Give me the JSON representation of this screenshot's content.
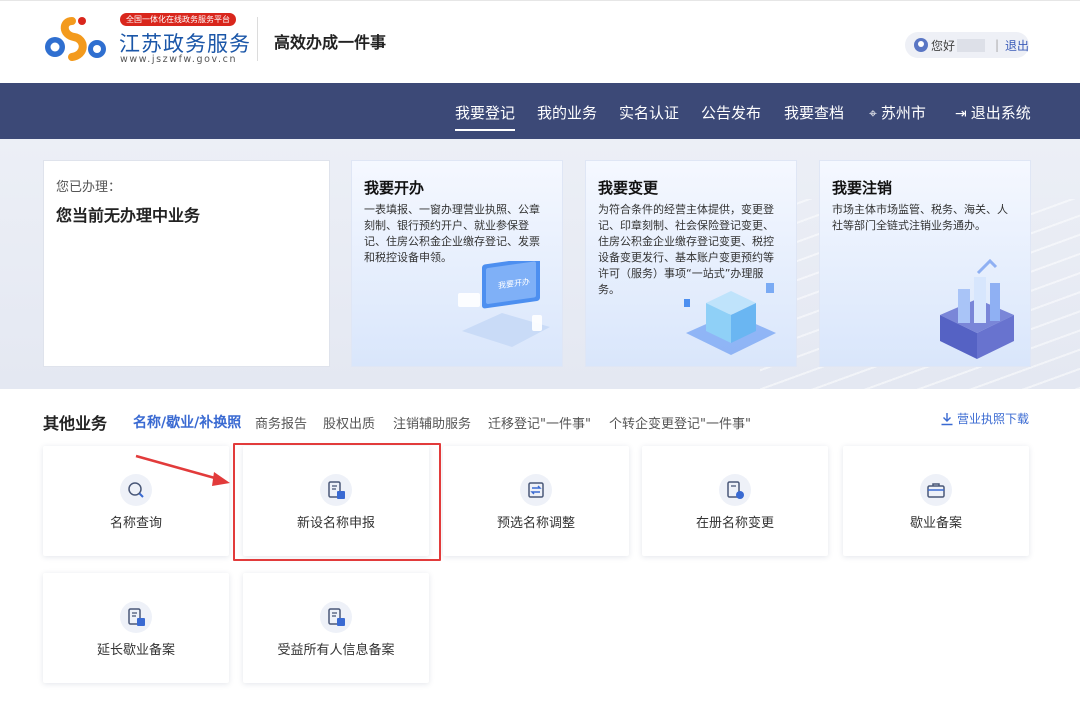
{
  "header": {
    "badge": "全国一体化在线政务服务平台",
    "site_name": "江苏政务服务",
    "site_url": "www.jszwfw.gov.cn",
    "slogan": "高效办成一件事",
    "greeting": "您好",
    "logout_label": "退出"
  },
  "nav": {
    "items": [
      {
        "label": "我要登记",
        "active": true
      },
      {
        "label": "我的业务"
      },
      {
        "label": "实名认证"
      },
      {
        "label": "公告发布"
      },
      {
        "label": "我要查档"
      },
      {
        "label": "苏州市",
        "icon": "location-pin-icon"
      },
      {
        "label": "退出系统",
        "icon": "exit-icon"
      }
    ]
  },
  "hero": {
    "status_label": "您已办理：",
    "status_value": "您当前无办理中业务",
    "cards": [
      {
        "title": "我要开办",
        "desc": "一表填报、一窗办理营业执照、公章刻制、银行预约开户、就业参保登记、住房公积金企业缴存登记、发票和税控设备申领。",
        "illus_text": "我要开办"
      },
      {
        "title": "我要变更",
        "desc": "为符合条件的经营主体提供，变更登记、印章刻制、社会保险登记变更、住房公积金企业缴存登记变更、税控设备变更发行、基本账户变更预约等许可（服务）事项“一站式”办理服务。"
      },
      {
        "title": "我要注销",
        "desc": "市场主体市场监管、税务、海关、人社等部门全链式注销业务通办。"
      }
    ]
  },
  "other": {
    "title": "其他业务",
    "tabs": [
      {
        "label": "名称/歇业/补换照",
        "active": true
      },
      {
        "label": "商务报告"
      },
      {
        "label": "股权出质"
      },
      {
        "label": "注销辅助服务"
      },
      {
        "label": "迁移登记\"一件事\""
      },
      {
        "label": "个转企变更登记\"一件事\""
      }
    ],
    "download_label": "营业执照下载",
    "items": [
      {
        "label": "名称查询",
        "icon": "name-search-icon"
      },
      {
        "label": "新设名称申报",
        "icon": "name-apply-icon",
        "highlighted": true
      },
      {
        "label": "预选名称调整",
        "icon": "name-adjust-icon"
      },
      {
        "label": "在册名称变更",
        "icon": "name-change-icon"
      },
      {
        "label": "歇业备案",
        "icon": "briefcase-icon"
      },
      {
        "label": "延长歇业备案",
        "icon": "extend-filing-icon"
      },
      {
        "label": "受益所有人信息备案",
        "icon": "beneficiary-filing-icon"
      }
    ]
  },
  "colors": {
    "nav_bg": "#3c4977",
    "accent": "#3a6ad2",
    "brand": "#1a56a8",
    "highlight": "#e23b3b"
  }
}
